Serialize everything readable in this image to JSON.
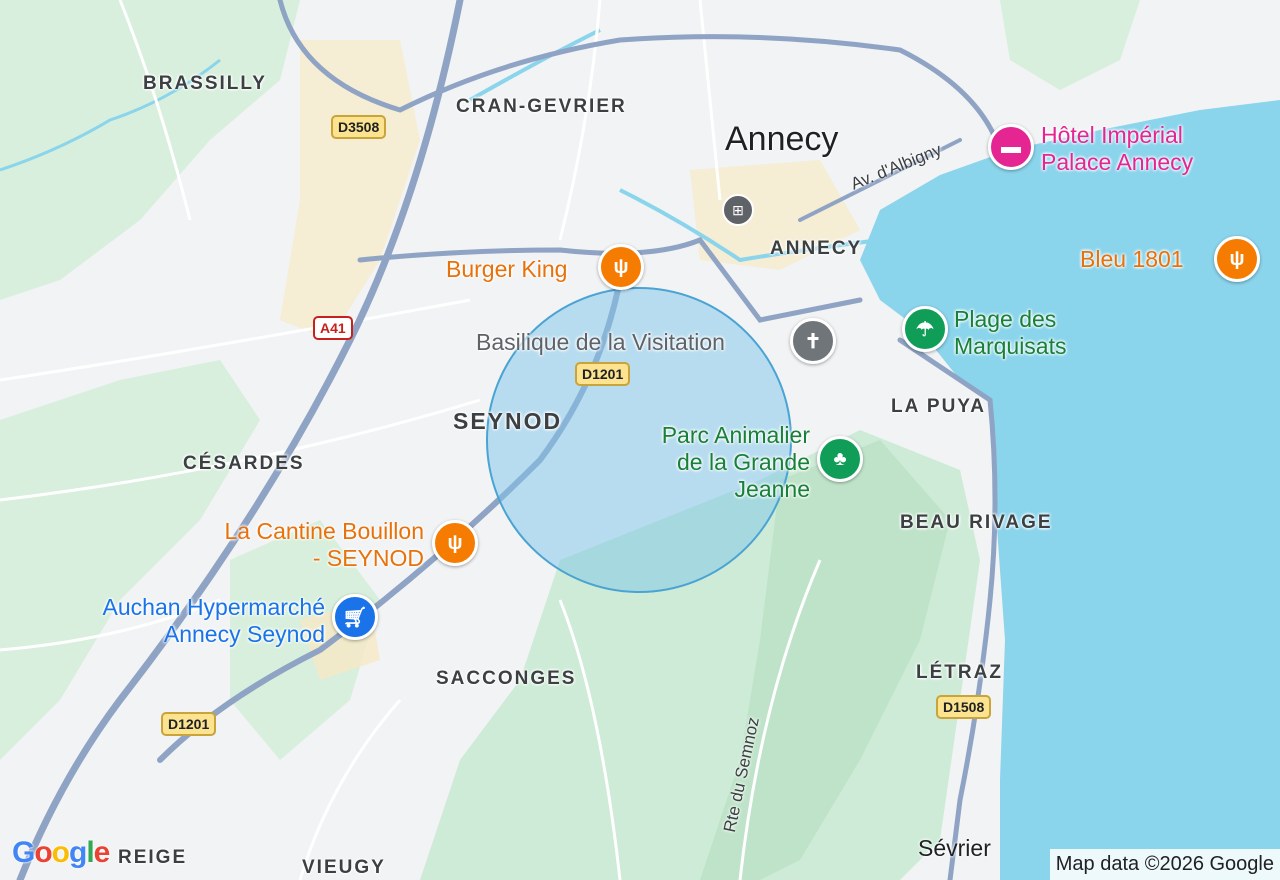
{
  "map": {
    "colors": {
      "water": "#8ad4ec",
      "land": "#f1f3f4",
      "park": "#cdebd6",
      "urban": "#f7e9c6",
      "road_major": "#8fa3c4",
      "circle_fill": "#7fc6ea",
      "circle_stroke": "#4aa3d3"
    },
    "places": {
      "annecy_city": "Annecy",
      "annecy_district": "ANNECY",
      "cran_gevrier": "CRAN-GEVRIER",
      "brassilly": "BRASSILLY",
      "seynod": "SEYNOD",
      "cesardes": "CÉSARDES",
      "la_puya": "LA PUYA",
      "beau_rivage": "BEAU RIVAGE",
      "sacconges": "SACCONGES",
      "letraz": "LÉTRAZ",
      "sevrier": "Sévrier",
      "vieugy": "VIEUGY",
      "reige": "REIGE"
    },
    "roads": {
      "d3508": "D3508",
      "a41": "A41",
      "d1201_top": "D1201",
      "d1201_bottom": "D1201",
      "d1508": "D1508",
      "albigny": "Av. d'Albigny",
      "semnoz": "Rte du Semnoz"
    },
    "pois": {
      "hotel_line1": "Hôtel Impérial",
      "hotel_line2": "Palace Annecy",
      "bleu": "Bleu 1801",
      "burger": "Burger King",
      "basilique": "Basilique de la Visitation",
      "plage_line1": "Plage des",
      "plage_line2": "Marquisats",
      "parc_line1": "Parc Animalier",
      "parc_line2": "de la Grande",
      "parc_line3": "Jeanne",
      "cantine_line1": "La Cantine Bouillon",
      "cantine_line2": "- SEYNOD",
      "auchan_line1": "Auchan Hypermarché",
      "auchan_line2": "Annecy Seynod"
    },
    "icons": {
      "hotel": "hotel-icon",
      "restaurant": "restaurant-icon",
      "church": "church-icon",
      "beach": "beach-icon",
      "park": "tree-icon",
      "shopping": "shopping-cart-icon",
      "train": "train-station-icon"
    },
    "attribution": "Map data ©2026 Google",
    "logo": "Google"
  }
}
